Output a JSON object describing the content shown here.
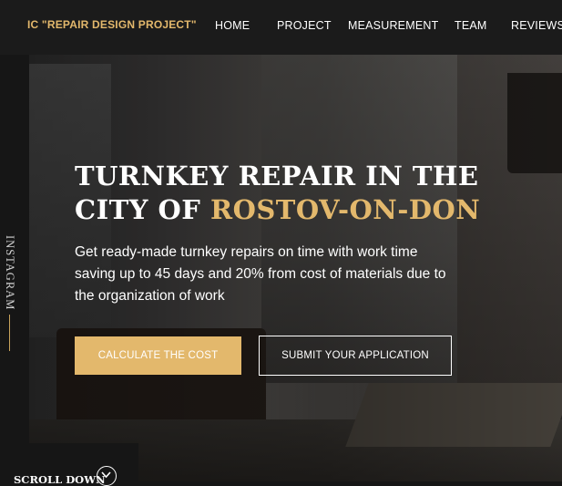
{
  "header": {
    "logo": "IC \"REPAIR DESIGN PROJECT\"",
    "nav": [
      "HOME",
      "PROJECT",
      "MEASUREMENT",
      "TEAM",
      "REVIEWS"
    ]
  },
  "sidebar": {
    "social_label": "INSTAGRAM"
  },
  "hero": {
    "title_line1": "TURNKEY REPAIR IN THE",
    "title_line2_prefix": "CITY OF ",
    "title_line2_accent": "ROSTOV-ON-DON",
    "subtitle": "Get ready-made turnkey repairs on time with work time saving up to 45 days and 20% from cost of materials due to the organization of work",
    "calc_button": "CALCULATE THE COST",
    "submit_button": "SUBMIT YOUR APPLICATION"
  },
  "scroll": {
    "label": "SCROLL DOWN",
    "icon": "chevron-down-icon"
  },
  "colors": {
    "accent": "#e3b86c",
    "background": "#161616",
    "text": "#ffffff"
  }
}
